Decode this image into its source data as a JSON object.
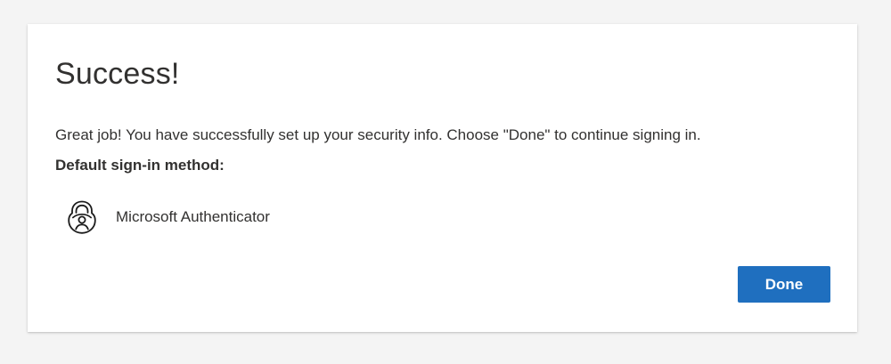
{
  "dialog": {
    "title": "Success!",
    "message": "Great job! You have successfully set up your security info. Choose \"Done\" to continue signing in.",
    "default_method_heading": "Default sign-in method:",
    "method": {
      "icon": "authenticator-lock-icon",
      "label": "Microsoft Authenticator"
    },
    "done_label": "Done"
  },
  "colors": {
    "background": "#f4f4f4",
    "card": "#ffffff",
    "text": "#323130",
    "primary_button": "#1f6fbf"
  }
}
